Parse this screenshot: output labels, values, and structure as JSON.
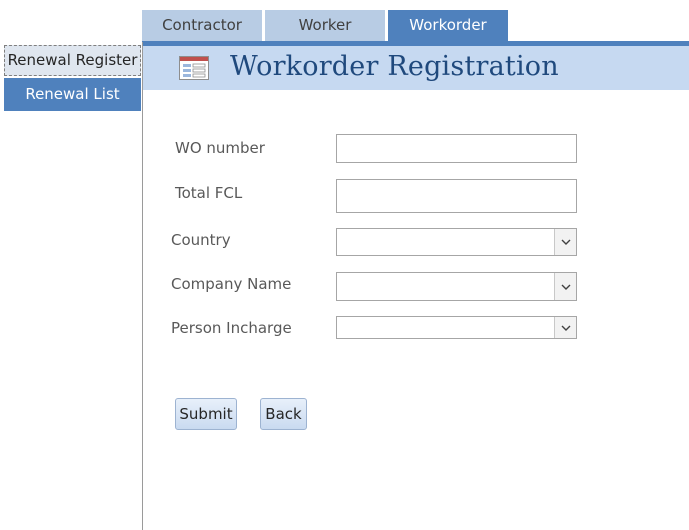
{
  "tabs": [
    {
      "label": "Contractor",
      "active": false
    },
    {
      "label": "Worker",
      "active": false
    },
    {
      "label": "Workorder",
      "active": true
    }
  ],
  "left_nav": {
    "items": [
      {
        "label": "Renewal Register",
        "selected": true
      },
      {
        "label": "Renewal List",
        "selected": false
      }
    ]
  },
  "header": {
    "title": "Workorder Registration",
    "icon": "form-icon"
  },
  "form": {
    "wo_number": {
      "label": "WO number",
      "value": ""
    },
    "total_fcl": {
      "label": "Total FCL",
      "value": ""
    },
    "country": {
      "label": "Country",
      "value": ""
    },
    "company_name": {
      "label": "Company Name",
      "value": ""
    },
    "person_incharge": {
      "label": "Person Incharge",
      "value": ""
    }
  },
  "buttons": {
    "submit": "Submit",
    "back": "Back"
  },
  "colors": {
    "accent": "#4f81bd",
    "tab_inactive": "#b8cce4",
    "header_band": "#c6d9f1",
    "title_text": "#1f497d"
  }
}
